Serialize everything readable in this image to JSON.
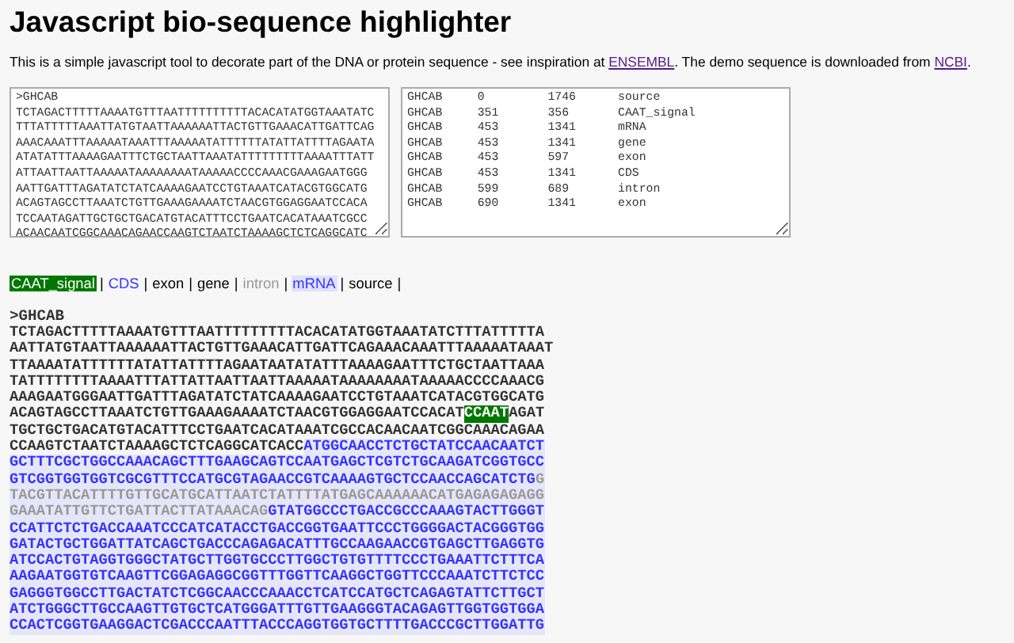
{
  "title": "Javascript bio-sequence highlighter",
  "intro": {
    "before": "This is a simple javascript tool to decorate part of the DNA or protein sequence - see inspiration at ",
    "link1": "ENSEMBL",
    "middle": ". The demo sequence is downloaded from ",
    "link2": "NCBI",
    "after": "."
  },
  "sequence_input": {
    "lines": [
      ">GHCAB",
      "TCTAGACTTTTTAAAATGTTTAATTTTTTTTTTACACATATGGTAAATATC",
      "TTTATTTTTAAATTATGTAATTAAAAAATTACTGTTGAAACATTGATTCAG",
      "AAACAAATTTAAAAATAAATTTAAAAATATTTTTTATATTATTTTAGAATA",
      "ATATATTTAAAAGAATTTCTGCTAATTAAATATTTTTTTTTAAAATTTATT",
      "ATTAATTAATTAAAAATAAAAAAAATAAAAACCCCAAACGAAAGAATGGG",
      "AATTGATTTAGATATCTATCAAAAGAATCCTGTAAATCATACGTGGCATG",
      "ACAGTAGCCTTAAATCTGTTGAAAGAAAATCTAACGTGGAGGAATCCACA",
      "TCCAATAGATTGCTGCTGACATGTACATTTCCTGAATCACATAAATCGCC",
      "ACAACAATCGGCAAACAGAACCAAGTCTAATCTAAAAGCTCTCAGGCATC"
    ]
  },
  "features_input": {
    "rows": [
      [
        "GHCAB",
        "0",
        "1746",
        "source"
      ],
      [
        "GHCAB",
        "351",
        "356",
        "CAAT_signal"
      ],
      [
        "GHCAB",
        "453",
        "1341",
        "mRNA"
      ],
      [
        "GHCAB",
        "453",
        "1341",
        "gene"
      ],
      [
        "GHCAB",
        "453",
        "597",
        "exon"
      ],
      [
        "GHCAB",
        "453",
        "1341",
        "CDS"
      ],
      [
        "GHCAB",
        "599",
        "689",
        "intron"
      ],
      [
        "GHCAB",
        "690",
        "1341",
        "exon"
      ]
    ]
  },
  "legend": {
    "separator": "|",
    "items": [
      {
        "label": "CAAT_signal",
        "kind": "caat"
      },
      {
        "label": "CDS",
        "kind": "cds"
      },
      {
        "label": "exon",
        "kind": "plain"
      },
      {
        "label": "gene",
        "kind": "plain"
      },
      {
        "label": "intron",
        "kind": "intron"
      },
      {
        "label": "mRNA",
        "kind": "mrna"
      },
      {
        "label": "source",
        "kind": "plain"
      }
    ]
  },
  "output": {
    "header": ">GHCAB",
    "lines": [
      [
        {
          "text": "TCTAGACTTTTTAAAATGTTTAATTTTTTTTTACACATATGGTAAATATCTTTATTTTTA",
          "kind": "plain"
        }
      ],
      [
        {
          "text": "AATTATGTAATTAAAAAATTACTGTTGAAACATTGATTCAGAAACAAATTTAAAAATAAAT",
          "kind": "plain"
        }
      ],
      [
        {
          "text": "TTAAAATATTTTTTATATTATTTTAGAATAATATATTTAAAAGAATTTCTGCTAATTAAA",
          "kind": "plain"
        }
      ],
      [
        {
          "text": "TATTTTTTTTAAAATTTATTATTAATTAATTAAAAATAAAAAAAATAAAAACCCCAAACG",
          "kind": "plain"
        }
      ],
      [
        {
          "text": "AAAGAATGGGAATTGATTTAGATATCTATCAAAAGAATCCTGTAAATCATACGTGGCATG",
          "kind": "plain"
        }
      ],
      [
        {
          "text": "ACAGTAGCCTTAAATCTGTTGAAAGAAAATCTAACGTGGAGGAATCCACAT",
          "kind": "plain"
        },
        {
          "text": "CCAAT",
          "kind": "caat"
        },
        {
          "text": "AGAT",
          "kind": "plain"
        }
      ],
      [
        {
          "text": "TGCTGCTGACATGTACATTTCCTGAATCACATAAATCGCCACAACAATCGGCAAACAGAA",
          "kind": "plain"
        }
      ],
      [
        {
          "text": "CCAAGTCTAATCTAAAAGCTCTCAGGCATCACC",
          "kind": "plain"
        },
        {
          "text": "ATGGCAACCTCTGCTATCCAACAATCT",
          "kind": "cds"
        }
      ],
      [
        {
          "text": "GCTTTCGCTGGCCAAACAGCTTTGAAGCAGTCCAATGAGCTCGTCTGCAAGATCGGTGCC",
          "kind": "cds"
        }
      ],
      [
        {
          "text": "GTCGGTGGTGGTCGCGTTTCCATGCGTAGAACCGTCAAAAGTGCTCCAACCAGCATCTG",
          "kind": "cds"
        },
        {
          "text": "G",
          "kind": "intron"
        }
      ],
      [
        {
          "text": "TACGTTACATTTTGTTGCATGCATTAATCTATTTTATGAGCAAAAAACATGAGAGAGAGG",
          "kind": "intron"
        }
      ],
      [
        {
          "text": "GAAATATTGTTCTGATTACTTATAAACAG",
          "kind": "intron"
        },
        {
          "text": "GTATGGCCCTGACCGCCCAAAGTACTTGGGT",
          "kind": "cds"
        }
      ],
      [
        {
          "text": "CCATTCTCTGACCAAATCCCATCATACCTGACCGGTGAATTCCCTGGGGACTACGGGTGG",
          "kind": "cds"
        }
      ],
      [
        {
          "text": "GATACTGCTGGATTATCAGCTGACCCAGAGACATTTGCCAAGAACCGTGAGCTTGAGGTG",
          "kind": "cds"
        }
      ],
      [
        {
          "text": "ATCCACTGTAGGTGGGCTATGCTTGGTGCCCTTGGCTGTGTTTTCCCTGAAATTCTTTCA",
          "kind": "cds"
        }
      ],
      [
        {
          "text": "AAGAATGGTGTCAAGTTCGGAGAGGCGGTTTGGTTCAAGGCTGGTTCCCAAATCTTCTCC",
          "kind": "cds"
        }
      ],
      [
        {
          "text": "GAGGGTGGCCTTGACTATCTCGGCAACCCAAACCTCATCCATGCTCAGAGTATTCTTGCT",
          "kind": "cds"
        }
      ],
      [
        {
          "text": "ATCTGGGCTTGCCAAGTTGTGCTCATGGGATTTGTTGAAGGGTACAGAGTTGGTGGTGGA",
          "kind": "cds"
        }
      ],
      [
        {
          "text": "CCACTCGGTGAAGGACTCGACCCAATTTACCCAGGTGGTGCTTTTGACCCGCTTGGATTG",
          "kind": "cds"
        }
      ]
    ]
  }
}
